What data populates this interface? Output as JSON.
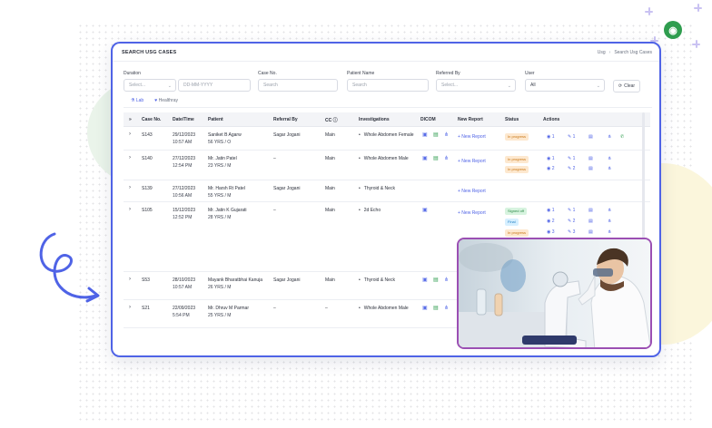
{
  "header": {
    "title": "SEARCH USG CASES",
    "breadcrumb": [
      "Usg",
      "Search Usg Cases"
    ]
  },
  "filters": {
    "duration": {
      "label": "Duration",
      "select_placeholder": "Select...",
      "date_placeholder": "DD-MM-YYYY"
    },
    "case_no": {
      "label": "Case No.",
      "placeholder": "Search"
    },
    "patient_name": {
      "label": "Patient Name",
      "placeholder": "Search"
    },
    "referred_by": {
      "label": "Referred By",
      "placeholder": "Select..."
    },
    "user": {
      "label": "User",
      "value": "All"
    },
    "clear_label": "Clear"
  },
  "tabs": [
    {
      "label": "Lab",
      "active": true
    },
    {
      "label": "Healthray",
      "active": false
    }
  ],
  "table": {
    "columns": [
      "Case No.",
      "Date/Time",
      "Patient",
      "Referral By",
      "CC",
      "Investigations",
      "DICOM",
      "New Report",
      "Status",
      "Actions"
    ],
    "new_report_label": "+ New Report",
    "rows": [
      {
        "case_no": "S143",
        "date": "29/12/2023",
        "time": "10:57 AM",
        "patient": "Saniket B Agarw",
        "patient_info": "56 YRS / O",
        "referral": "Sagar Jogani",
        "cc": "Main",
        "investigations": [
          "Whole Abdomen Female"
        ],
        "dicom": true,
        "new_report": true,
        "statuses": [
          "In progress"
        ],
        "actions": [
          [
            "1",
            "1"
          ]
        ]
      },
      {
        "case_no": "S140",
        "date": "27/12/2023",
        "time": "12:54 PM",
        "patient": "Mr. Jatin Patel",
        "patient_info": "23 YRS / M",
        "referral": "–",
        "cc": "Main",
        "investigations": [
          "Whole Abdomen Male"
        ],
        "dicom": true,
        "new_report": true,
        "statuses": [
          "In progress",
          "In progress"
        ],
        "actions": [
          [
            "1",
            "1"
          ],
          [
            "2",
            "2"
          ]
        ]
      },
      {
        "case_no": "S139",
        "date": "27/12/2023",
        "time": "10:56 AM",
        "patient": "Mr. Harsh Rt Patel",
        "patient_info": "55 YRS / M",
        "referral": "Sagar Jogani",
        "cc": "Main",
        "investigations": [
          "Thyroid & Neck"
        ],
        "dicom": false,
        "new_report": true,
        "statuses": [],
        "actions": []
      },
      {
        "case_no": "S105",
        "date": "15/12/2023",
        "time": "12:52 PM",
        "patient": "Mr. Jatin K Gujarati",
        "patient_info": "28 YRS / M",
        "referral": "–",
        "cc": "Main",
        "investigations": [
          "2d Echo"
        ],
        "dicom": true,
        "new_report": true,
        "statuses": [
          "Signed off",
          "Final",
          "In progress"
        ],
        "actions": [
          [
            "1",
            "1"
          ],
          [
            "2",
            "2"
          ],
          [
            "3",
            "3"
          ]
        ]
      },
      {
        "case_no": "S53",
        "date": "28/10/2023",
        "time": "10:57 AM",
        "patient": "Mayank Bharatbhai Kanuja",
        "patient_info": "26 YRS / M",
        "referral": "Sagar Jogani",
        "cc": "Main",
        "investigations": [
          "Thyroid & Neck"
        ],
        "dicom": true,
        "new_report": false,
        "statuses": [],
        "actions": []
      },
      {
        "case_no": "S21",
        "date": "22/09/2023",
        "time": "5:54 PM",
        "patient": "Mr. Dhruv M Parmar",
        "patient_info": "25 YRS / M",
        "referral": "–",
        "cc": "–",
        "investigations": [
          "Whole Abdomen Male"
        ],
        "dicom": true,
        "new_report": false,
        "statuses": [],
        "actions": []
      }
    ]
  },
  "colors": {
    "accent": "#4f63e6",
    "photo_frame": "#9b4fb3",
    "status_in_progress": "#c87614",
    "status_signed_off": "#2c8a48",
    "status_final": "#2381c4"
  }
}
